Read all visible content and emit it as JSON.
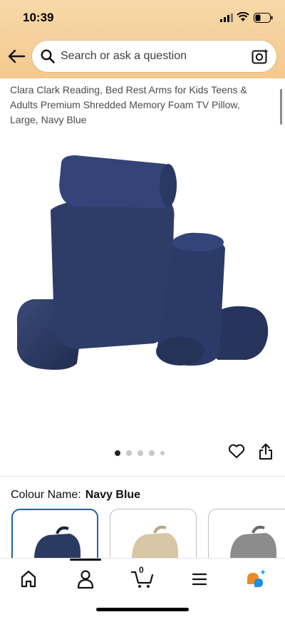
{
  "status_bar": {
    "time": "10:39"
  },
  "search": {
    "placeholder": "Search or ask a question"
  },
  "product": {
    "title": "Clara Clark Reading, Bed Rest Arms for Kids Teens & Adults Premium Shredded Memory Foam TV Pillow, Large, Navy Blue",
    "image_icon": "navy-bed-rest-pillow",
    "image_count": 5,
    "active_image_index": 0
  },
  "colour": {
    "label": "Colour Name:",
    "selected": "Navy Blue",
    "swatches": [
      {
        "name": "navy",
        "color": "#2B3A63"
      },
      {
        "name": "beige",
        "color": "#D9C6A6"
      },
      {
        "name": "grey",
        "color": "#8C8C8C"
      }
    ]
  },
  "nav": {
    "items": [
      "home-icon",
      "account-icon",
      "cart-icon",
      "menu-icon",
      "rufus-icon"
    ],
    "cart_count": "0"
  },
  "colors": {
    "header": "#F3C98E",
    "selected_border": "#2162A1",
    "navy": "#2B3A63"
  }
}
